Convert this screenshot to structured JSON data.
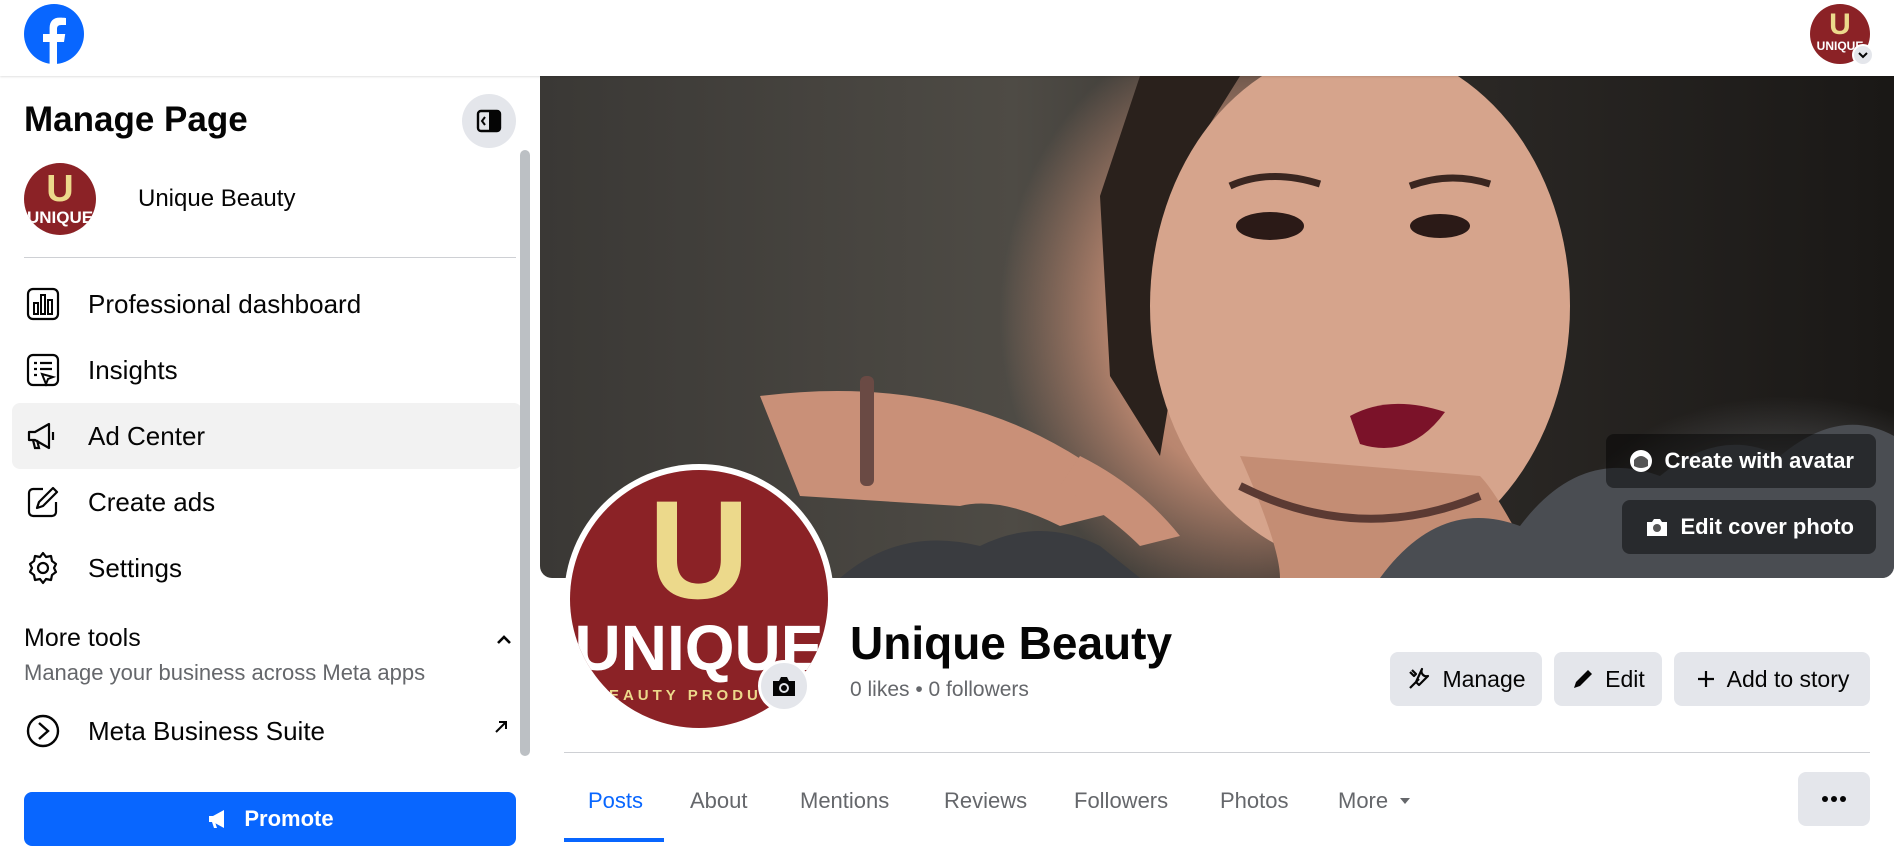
{
  "header": {
    "logo_icon": "facebook-logo-icon",
    "account_icon": "account-avatar"
  },
  "brand": {
    "logo_letter": "U",
    "logo_word": "UNIQUE",
    "logo_small": "BEAUTY PRODUCTS",
    "color_maroon": "#8b2226",
    "color_gold": "#ecd98b"
  },
  "sidebar": {
    "title": "Manage Page",
    "page_name": "Unique Beauty",
    "items": [
      {
        "label": "Professional dashboard",
        "icon": "dashboard-icon"
      },
      {
        "label": "Insights",
        "icon": "insights-icon"
      },
      {
        "label": "Ad Center",
        "icon": "megaphone-icon"
      },
      {
        "label": "Create ads",
        "icon": "pencil-square-icon"
      },
      {
        "label": "Settings",
        "icon": "gear-icon"
      }
    ],
    "more_tools_title": "More tools",
    "more_tools_subtitle": "Manage your business across Meta apps",
    "meta_business_suite": "Meta Business Suite",
    "promote_label": "Promote"
  },
  "cover": {
    "create_avatar_label": "Create with avatar",
    "edit_cover_label": "Edit cover photo"
  },
  "profile": {
    "name": "Unique Beauty",
    "stats": "0 likes • 0 followers",
    "manage_label": "Manage",
    "edit_label": "Edit",
    "add_story_label": "Add to story"
  },
  "tabs": [
    "Posts",
    "About",
    "Mentions",
    "Reviews",
    "Followers",
    "Photos",
    "More"
  ],
  "colors": {
    "accent": "#0866ff",
    "button_gray": "#e4e6eb"
  }
}
